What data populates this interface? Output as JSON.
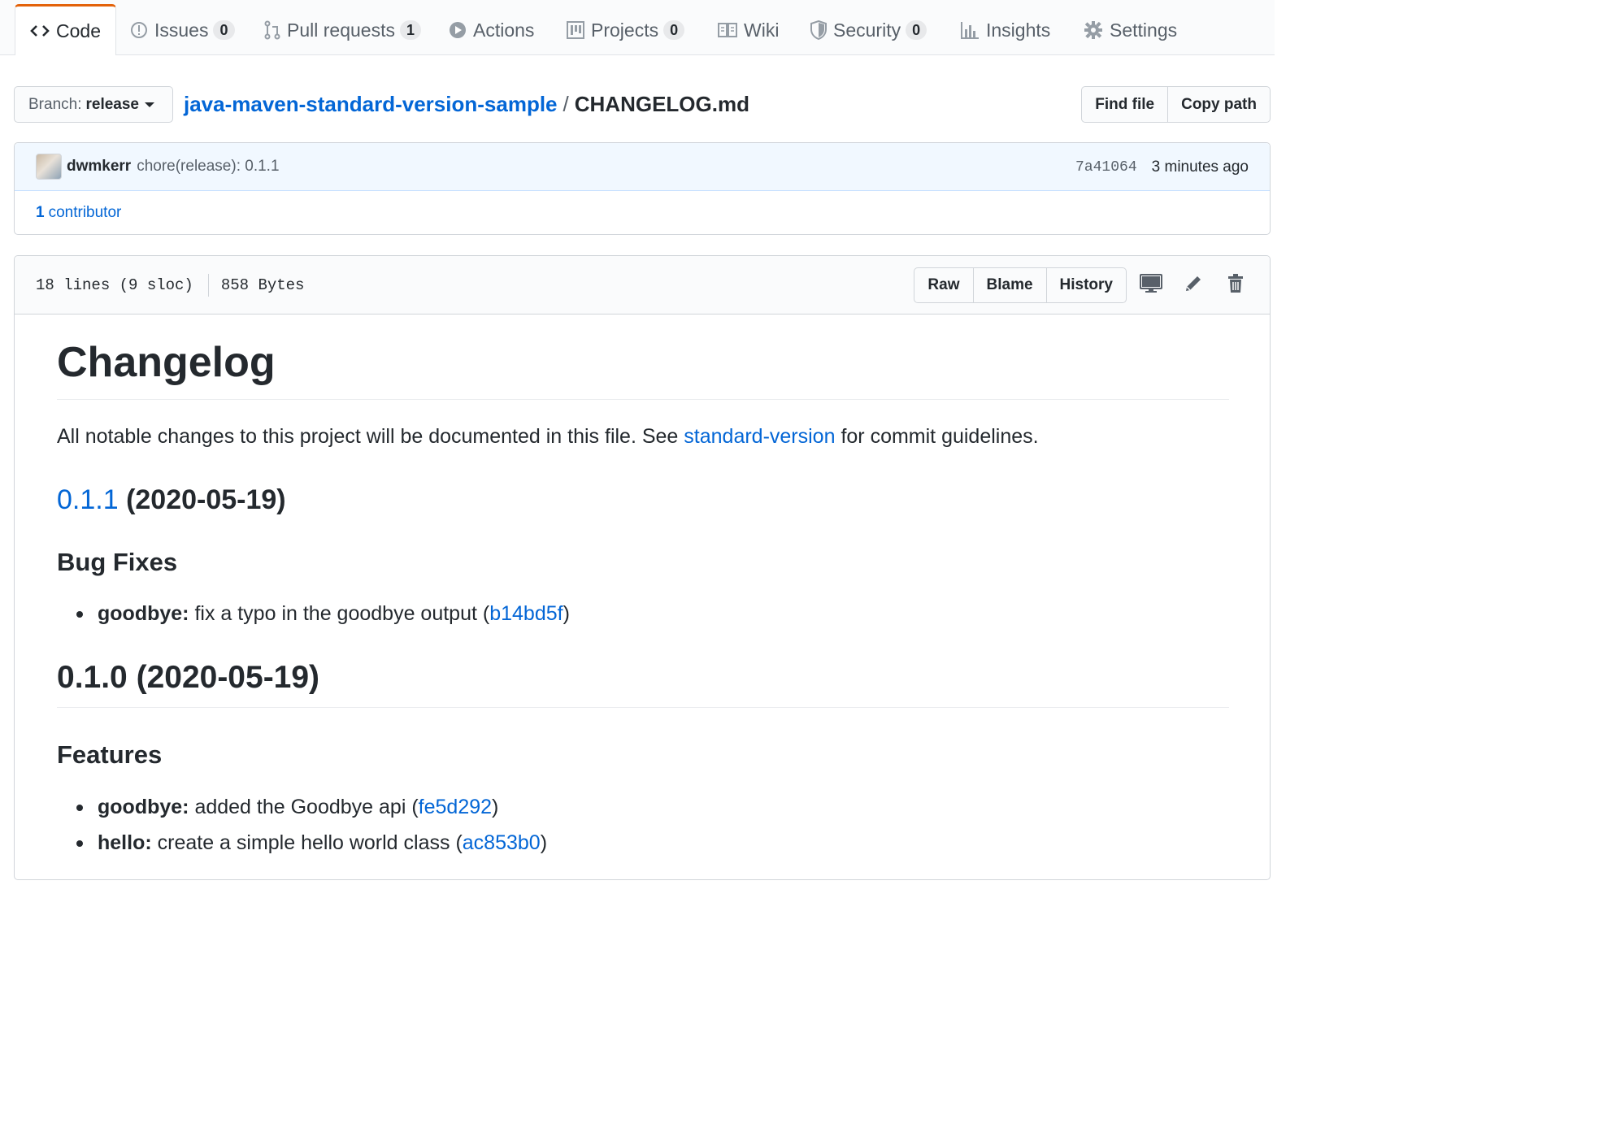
{
  "tabs": [
    {
      "label": "Code",
      "icon": "code-icon"
    },
    {
      "label": "Issues",
      "count": "0",
      "icon": "issue-opened-icon"
    },
    {
      "label": "Pull requests",
      "count": "1",
      "icon": "git-pull-request-icon"
    },
    {
      "label": "Actions",
      "icon": "play-icon"
    },
    {
      "label": "Projects",
      "count": "0",
      "icon": "project-icon"
    },
    {
      "label": "Wiki",
      "icon": "book-icon"
    },
    {
      "label": "Security",
      "count": "0",
      "icon": "shield-icon"
    },
    {
      "label": "Insights",
      "icon": "graph-icon"
    },
    {
      "label": "Settings",
      "icon": "gear-icon"
    }
  ],
  "branch": {
    "prefix": "Branch:",
    "name": "release"
  },
  "breadcrumb": {
    "repo": "java-maven-standard-version-sample",
    "separator": "/",
    "file": "CHANGELOG.md"
  },
  "path_actions": {
    "find_file": "Find file",
    "copy_path": "Copy path"
  },
  "commit": {
    "author": "dwmkerr",
    "message": "chore(release): 0.1.1",
    "sha": "7a41064",
    "time": "3 minutes ago",
    "contributors_count": "1",
    "contributors_label": "contributor"
  },
  "file_info": {
    "lines": "18 lines (9 sloc)",
    "size": "858 Bytes"
  },
  "file_actions": {
    "raw": "Raw",
    "blame": "Blame",
    "history": "History"
  },
  "markdown": {
    "title": "Changelog",
    "intro_before": "All notable changes to this project will be documented in this file. See ",
    "intro_link": "standard-version",
    "intro_after": " for commit guidelines.",
    "release1": {
      "version": "0.1.1",
      "date": " (2020-05-19)"
    },
    "bugfixes_heading": "Bug Fixes",
    "bugfix1": {
      "scope": "goodbye:",
      "text": " fix a typo in the goodbye output (",
      "hash": "b14bd5f",
      "close": ")"
    },
    "release2": {
      "title": "0.1.0 (2020-05-19)"
    },
    "features_heading": "Features",
    "feature1": {
      "scope": "goodbye:",
      "text": " added the Goodbye api (",
      "hash": "fe5d292",
      "close": ")"
    },
    "feature2": {
      "scope": "hello:",
      "text": " create a simple hello world class (",
      "hash": "ac853b0",
      "close": ")"
    }
  },
  "colors": {
    "accent_tab": "#e36209",
    "link": "#0366d6",
    "text": "#24292e",
    "muted": "#586069",
    "commit_bg": "#f1f8ff"
  }
}
